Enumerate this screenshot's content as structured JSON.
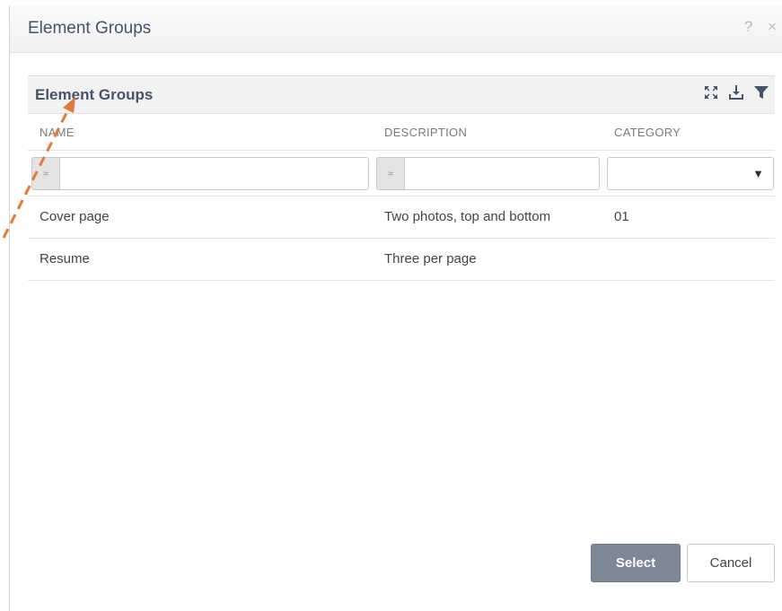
{
  "dialog": {
    "title": "Element Groups",
    "help_icon": "?",
    "close_icon": "×"
  },
  "panel": {
    "title": "Element Groups",
    "tools": [
      "expand-icon",
      "download-icon",
      "filter-icon"
    ]
  },
  "columns": {
    "name": "NAME",
    "description": "DESCRIPTION",
    "category": "CATEGORY"
  },
  "filters": {
    "name_operator": "≈",
    "name_value": "",
    "description_operator": "≈",
    "description_value": "",
    "category_value": "",
    "category_caret": "▼"
  },
  "rows": [
    {
      "name": "Cover page",
      "description": "Two photos, top and bottom",
      "category": "01"
    },
    {
      "name": "Resume",
      "description": "Three per page",
      "category": ""
    }
  ],
  "buttons": {
    "select": "Select",
    "cancel": "Cancel"
  },
  "colors": {
    "accent_text": "#44546a",
    "select_button": "#7c8896",
    "annotation_arrow": "#e07b39"
  }
}
